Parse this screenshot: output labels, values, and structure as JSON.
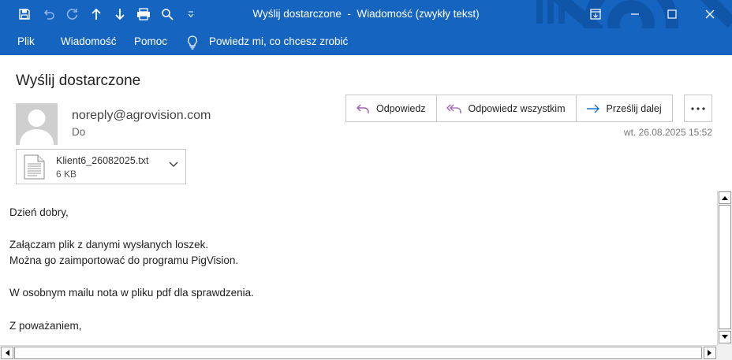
{
  "window": {
    "title": "Wyślij dostarczone  -  Wiadomość (zwykły tekst)"
  },
  "quick_access": {
    "icons": [
      "save-icon",
      "undo-icon",
      "redo-icon",
      "previous-item-icon",
      "next-item-icon",
      "print-icon",
      "search-icon",
      "customize-quick-access-icon"
    ]
  },
  "window_controls": {
    "icons": [
      "ribbon-display-options-icon",
      "minimize-icon",
      "maximize-icon",
      "close-icon"
    ]
  },
  "menu": {
    "file": "Plik",
    "message": "Wiadomość",
    "help": "Pomoc",
    "tell_me": "Powiedz mi, co chcesz zrobić"
  },
  "message": {
    "subject": "Wyślij dostarczone",
    "sender": "noreply@agrovision.com",
    "to_label": "Do",
    "date": "wt. 26.08.2025 15:52"
  },
  "actions": {
    "reply": "Odpowiedz",
    "reply_all": "Odpowiedz wszystkim",
    "forward": "Prześlij dalej",
    "more_icon": "more-options-icon"
  },
  "attachment": {
    "name": "Klient6_26082025.txt",
    "size": "6 KB"
  },
  "body": {
    "lines": [
      "Dzień dobry,",
      "Załączam plik z danymi wysłanych loszek.",
      "Można go zaimportować do programu PigVision.",
      "W osobnym mailu nota w pliku pdf dla sprawdzenia.",
      "Z poważaniem,"
    ]
  },
  "colors": {
    "titlebar": "#1565c0",
    "reply_arrow": "#a05fb0",
    "forward_arrow": "#1a73c8"
  }
}
